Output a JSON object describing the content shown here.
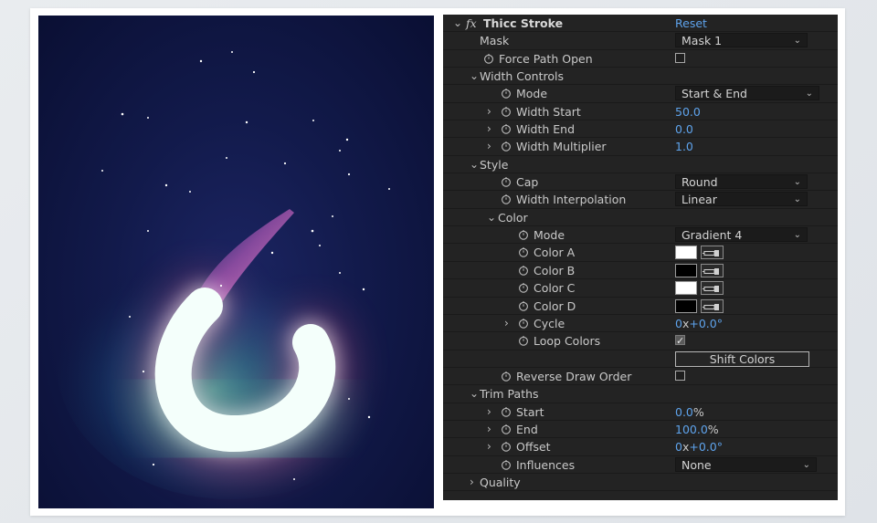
{
  "effect": {
    "fx_label": "fx",
    "name": "Thicc Stroke",
    "reset_label": "Reset"
  },
  "rows": {
    "mask": {
      "label": "Mask",
      "value": "Mask 1"
    },
    "force_path_open": {
      "label": "Force Path Open",
      "checked": false
    },
    "width_controls": {
      "label": "Width Controls"
    },
    "mode": {
      "label": "Mode",
      "value": "Start & End"
    },
    "width_start": {
      "label": "Width Start",
      "value": "50.0"
    },
    "width_end": {
      "label": "Width End",
      "value": "0.0"
    },
    "width_multiplier": {
      "label": "Width Multiplier",
      "value": "1.0"
    },
    "style": {
      "label": "Style"
    },
    "cap": {
      "label": "Cap",
      "value": "Round"
    },
    "width_interpolation": {
      "label": "Width Interpolation",
      "value": "Linear"
    },
    "color": {
      "label": "Color"
    },
    "color_mode": {
      "label": "Mode",
      "value": "Gradient 4"
    },
    "color_a": {
      "label": "Color A",
      "swatch": "#ffffff"
    },
    "color_b": {
      "label": "Color B",
      "swatch": "#000000"
    },
    "color_c": {
      "label": "Color C",
      "swatch": "#ffffff"
    },
    "color_d": {
      "label": "Color D",
      "swatch": "#000000"
    },
    "cycle": {
      "label": "Cycle",
      "rev": "0",
      "x": "x",
      "deg": "+0.0°"
    },
    "loop_colors": {
      "label": "Loop Colors",
      "checked": true
    },
    "shift_colors": {
      "label": "Shift Colors"
    },
    "reverse_draw_order": {
      "label": "Reverse Draw Order",
      "checked": false
    },
    "trim_paths": {
      "label": "Trim Paths"
    },
    "start": {
      "label": "Start",
      "value": "0.0",
      "unit": "%"
    },
    "end": {
      "label": "End",
      "value": "100.0",
      "unit": "%"
    },
    "offset": {
      "label": "Offset",
      "rev": "0",
      "x": "x",
      "deg": "+0.0°"
    },
    "influences": {
      "label": "Influences",
      "value": "None"
    },
    "quality": {
      "label": "Quality"
    }
  },
  "icons": {
    "stopwatch": "stopwatch-icon",
    "chevron_right": "chevron-right-icon",
    "chevron_down": "chevron-down-icon",
    "eyedropper": "eyedropper-icon"
  },
  "colors": {
    "panel_bg": "#232323",
    "value_blue": "#5ea3ec",
    "preview_bg": "#121a4b"
  }
}
